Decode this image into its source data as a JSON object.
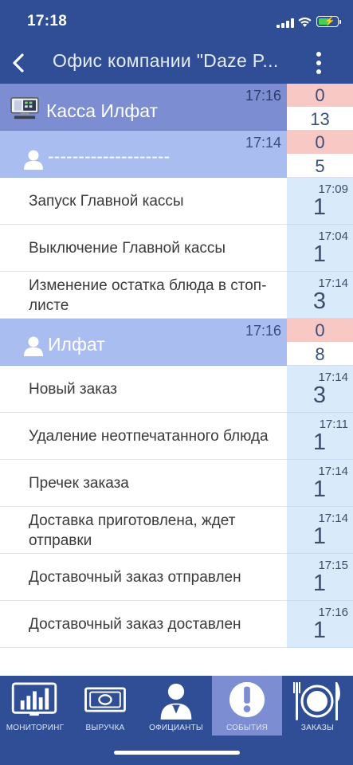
{
  "status_bar": {
    "time": "17:18"
  },
  "nav": {
    "title": "Офис компании \"Daze P...",
    "back_icon": "chevron-left-icon",
    "more_icon": "vertical-ellipsis-icon"
  },
  "groups": [
    {
      "icon": "cash-register-icon",
      "name": "Касса Илфат",
      "time": "17:16",
      "top": "0",
      "bottom": "13"
    },
    {
      "icon": "user-icon",
      "name": "--------------------",
      "time": "17:14",
      "top": "0",
      "bottom": "5",
      "events": [
        {
          "text": "Запуск Главной кассы",
          "time": "17:09",
          "count": "1"
        },
        {
          "text": "Выключение Главной кассы",
          "time": "17:04",
          "count": "1"
        },
        {
          "text": "Изменение остатка блюда в стоп-листе",
          "time": "17:14",
          "count": "3"
        }
      ]
    },
    {
      "icon": "user-icon",
      "name": "Илфат",
      "time": "17:16",
      "top": "0",
      "bottom": "8",
      "events": [
        {
          "text": "Новый заказ",
          "time": "17:14",
          "count": "3"
        },
        {
          "text": "Удаление неотпечатанного блюда",
          "time": "17:11",
          "count": "1"
        },
        {
          "text": "Пречек заказа",
          "time": "17:14",
          "count": "1"
        },
        {
          "text": "Доставка приготовлена, ждет отправки",
          "time": "17:14",
          "count": "1"
        },
        {
          "text": "Доставочный заказ отправлен",
          "time": "17:15",
          "count": "1"
        },
        {
          "text": "Доставочный заказ доставлен",
          "time": "17:16",
          "count": "1"
        }
      ]
    }
  ],
  "tabs": [
    {
      "label": "МОНИТОРИНГ",
      "icon": "monitor-chart-icon",
      "active": false
    },
    {
      "label": "ВЫРУЧКА",
      "icon": "banknote-icon",
      "active": false
    },
    {
      "label": "ОФИЦИАНТЫ",
      "icon": "waiter-icon",
      "active": false
    },
    {
      "label": "СОБЫТИЯ",
      "icon": "exclamation-icon",
      "active": true
    },
    {
      "label": "ЗАКАЗЫ",
      "icon": "plate-cutlery-icon",
      "active": false
    }
  ],
  "colors": {
    "header": "#2f4e96",
    "group_primary": "#7c8dd1",
    "group_secondary": "#a9bdf0",
    "badge_red": "#f7c8c4",
    "count_bg": "#d9eafb"
  }
}
